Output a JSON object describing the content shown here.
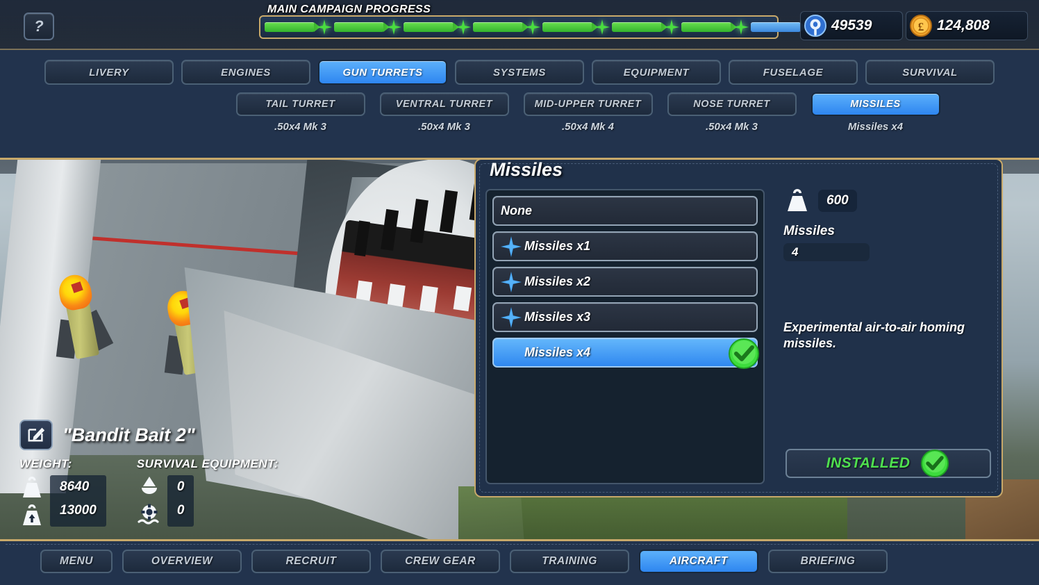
{
  "header": {
    "help_label": "?",
    "campaign_title": "MAIN CAMPAIGN PROGRESS",
    "progress": {
      "total_segments": 8,
      "completed_segments": 7,
      "current_segment_color": "#4494e4",
      "completed_color": "#3fb730"
    },
    "resources": [
      {
        "icon": "research-icon",
        "value": "49539"
      },
      {
        "icon": "money-pound-icon",
        "value": "124,808"
      }
    ]
  },
  "tabs": {
    "primary": [
      {
        "label": "LIVERY",
        "active": false
      },
      {
        "label": "ENGINES",
        "active": false
      },
      {
        "label": "GUN TURRETS",
        "active": true
      },
      {
        "label": "SYSTEMS",
        "active": false
      },
      {
        "label": "EQUIPMENT",
        "active": false
      },
      {
        "label": "FUSELAGE",
        "active": false
      },
      {
        "label": "SURVIVAL",
        "active": false
      }
    ],
    "secondary": [
      {
        "label": "TAIL TURRET",
        "sublabel": ".50x4 Mk 3",
        "active": false
      },
      {
        "label": "VENTRAL TURRET",
        "sublabel": ".50x4 Mk 3",
        "active": false
      },
      {
        "label": "MID-UPPER TURRET",
        "sublabel": ".50x4 Mk 4",
        "active": false
      },
      {
        "label": "NOSE TURRET",
        "sublabel": ".50x4 Mk 3",
        "active": false
      },
      {
        "label": "MISSILES",
        "sublabel": "Missiles x4",
        "active": true
      }
    ]
  },
  "panel": {
    "title": "Missiles",
    "options": [
      {
        "label": "None",
        "has_star": false,
        "selected": false
      },
      {
        "label": "Missiles x1",
        "has_star": true,
        "selected": false
      },
      {
        "label": "Missiles x2",
        "has_star": true,
        "selected": false
      },
      {
        "label": "Missiles x3",
        "has_star": true,
        "selected": false
      },
      {
        "label": "Missiles x4",
        "has_star": false,
        "selected": true
      }
    ],
    "details": {
      "weight_icon": "weight-icon",
      "weight_value": "600",
      "stat_label": "Missiles",
      "stat_value": "4",
      "description": "Experimental air-to-air homing missiles."
    },
    "install_button": {
      "label": "INSTALLED",
      "icon": "check-circle-icon",
      "color": "#4fe04f"
    }
  },
  "aircraft": {
    "edit_icon": "edit-pencil-icon",
    "name": "\"Bandit Bait 2\"",
    "weight": {
      "header": "WEIGHT:",
      "rows": [
        {
          "icon": "weight-icon",
          "value": "8640"
        },
        {
          "icon": "max-weight-icon",
          "value": "13000"
        }
      ]
    },
    "survival": {
      "header": "SURVIVAL EQUIPMENT:",
      "rows": [
        {
          "icon": "parachute-icon",
          "value": "0"
        },
        {
          "icon": "life-ring-icon",
          "value": "0"
        }
      ]
    }
  },
  "bottom_nav": [
    {
      "label": "MENU",
      "active": false,
      "wide": false
    },
    {
      "label": "OVERVIEW",
      "active": false,
      "wide": true
    },
    {
      "label": "RECRUIT",
      "active": false,
      "wide": true
    },
    {
      "label": "CREW GEAR",
      "active": false,
      "wide": true
    },
    {
      "label": "TRAINING",
      "active": false,
      "wide": true
    },
    {
      "label": "AIRCRAFT",
      "active": true,
      "wide": true
    },
    {
      "label": "BRIEFING",
      "active": false,
      "wide": true
    }
  ]
}
